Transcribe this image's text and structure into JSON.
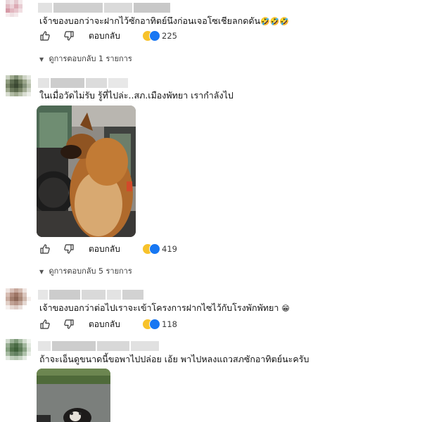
{
  "comments": [
    {
      "text": "เจ้าของบอกว่าจะฝากไว้ซักอาทิตย์นึงก่อนเจอโซเชียลกดดัน",
      "emoji": "🤣🤣🤣",
      "reply_label": "ตอบกลับ",
      "reaction_count": "225",
      "replies_label": "ดูการตอบกลับ 1 รายการ"
    },
    {
      "text": "ในเมื่อวัดไม่รับ รู้ที่ไปล่ะ..สภ.เมืองพัทยา เรากำลังไป",
      "emoji": "",
      "reply_label": "ตอบกลับ",
      "reaction_count": "419",
      "replies_label": "ดูการตอบกลับ 5 รายการ"
    },
    {
      "text": "เจ้าของบอกว่าต่อไปเราจะเข้าโครงการฝากไซไว้กับโรงพักพัทยา",
      "emoji": "😁",
      "reply_label": "ตอบกลับ",
      "reaction_count": "118"
    },
    {
      "text": "ถ้าจะเอ็นดูขนาดนี้ขอพาไปปล่อย เอ้ย พาไปหลงแถวสภซักอาทิตย์นะครับ",
      "emoji": ""
    }
  ],
  "icons": {
    "like": "thumbs-up-icon",
    "dislike": "thumbs-down-icon",
    "haha": "haha-reaction-icon",
    "like_reaction": "like-reaction-icon",
    "chevron": "chevron-down-icon"
  },
  "colors": {
    "text": "#0f0f0f",
    "secondary": "#3b3b3b",
    "like_blue": "#1877f2",
    "haha_yellow": "#f7c22b"
  }
}
